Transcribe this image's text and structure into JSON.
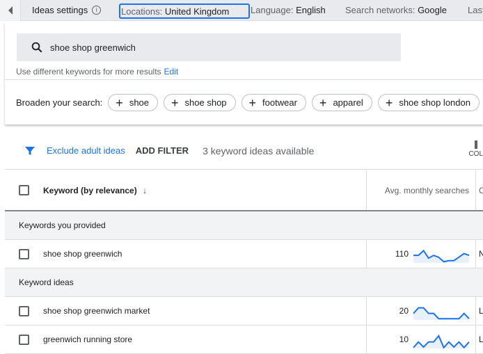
{
  "topbar": {
    "title": "Ideas settings",
    "locations_key": "Locations:",
    "locations_val": "United Kingdom",
    "language_key": "Language:",
    "language_val": "English",
    "networks_key": "Search networks:",
    "networks_val": "Google",
    "last": "Last"
  },
  "search": {
    "value": "shoe shop greenwich",
    "hint": "Use different keywords for more results",
    "edit": "Edit"
  },
  "broaden": {
    "label": "Broaden your search:",
    "chips": [
      "shoe",
      "shoe shop",
      "footwear",
      "apparel",
      "shoe shop london"
    ]
  },
  "filters": {
    "exclude": "Exclude adult ideas",
    "add": "ADD FILTER",
    "count": "3 keyword ideas available",
    "columns": "COL"
  },
  "table": {
    "col_keyword": "Keyword (by relevance)",
    "col_searches": "Avg. monthly searches",
    "col_next": "C",
    "group1": "Keywords you provided",
    "group2": "Keyword ideas",
    "rows": [
      {
        "keyword": "shoe shop greenwich",
        "searches": "110",
        "next": "N",
        "trend": [
          43,
          43,
          70,
          27,
          43,
          32,
          7,
          13,
          13,
          33,
          53,
          43
        ]
      },
      {
        "keyword": "shoe shop greenwich market",
        "searches": "20",
        "next": "L",
        "trend": [
          37,
          69,
          69,
          37,
          37,
          7,
          7,
          7,
          7,
          7,
          37,
          7
        ]
      },
      {
        "keyword": "greenwich running store",
        "searches": "10",
        "next": "L",
        "trend": [
          5,
          37,
          8,
          37,
          37,
          72,
          5,
          37,
          8,
          37,
          5,
          37
        ]
      }
    ]
  },
  "colors": {
    "accent": "#1a73e8",
    "spark_fill": "#e8f0fe"
  }
}
